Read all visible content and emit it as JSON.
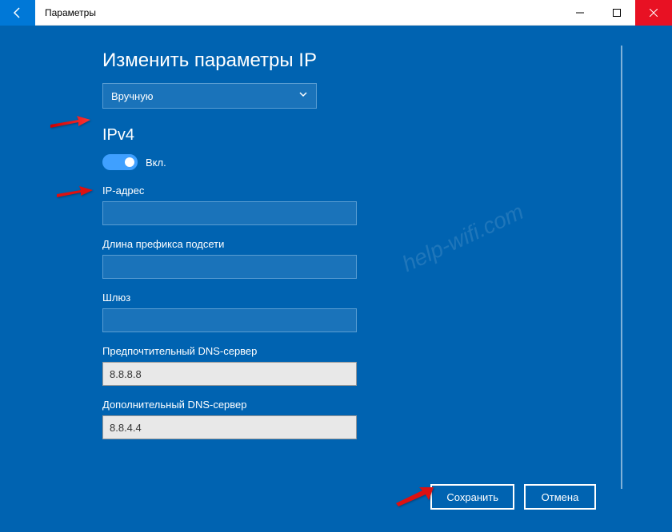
{
  "titlebar": {
    "title": "Параметры"
  },
  "page": {
    "heading": "Изменить параметры IP"
  },
  "dropdown": {
    "selected": "Вручную"
  },
  "ipv4": {
    "section_title": "IPv4",
    "toggle_label": "Вкл.",
    "toggle_on": true
  },
  "fields": {
    "ip_address": {
      "label": "IP-адрес",
      "value": ""
    },
    "prefix_length": {
      "label": "Длина префикса подсети",
      "value": ""
    },
    "gateway": {
      "label": "Шлюз",
      "value": ""
    },
    "preferred_dns": {
      "label": "Предпочтительный DNS-сервер",
      "value": "8.8.8.8"
    },
    "alternate_dns": {
      "label": "Дополнительный DNS-сервер",
      "value": "8.8.4.4"
    }
  },
  "buttons": {
    "save": "Сохранить",
    "cancel": "Отмена"
  },
  "watermark": "help-wifi.com"
}
